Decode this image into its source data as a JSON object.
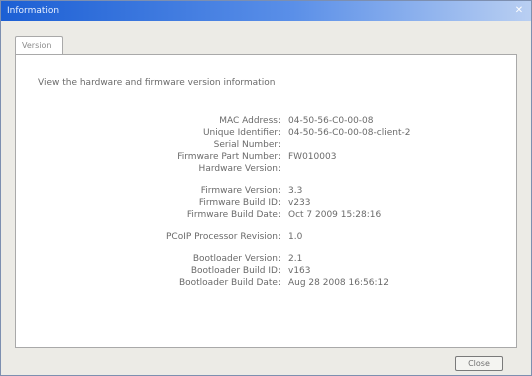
{
  "window": {
    "title": "Information",
    "close_glyph": "✕"
  },
  "tabs": [
    {
      "label": "Version"
    }
  ],
  "panel": {
    "description": "View the hardware and firmware version information",
    "fields": [
      {
        "label": "MAC Address:",
        "value": "04-50-56-C0-00-08"
      },
      {
        "label": "Unique Identifier:",
        "value": "04-50-56-C0-00-08-client-2"
      },
      {
        "label": "Serial Number:",
        "value": ""
      },
      {
        "label": "Firmware Part Number:",
        "value": "FW010003"
      },
      {
        "label": "Hardware Version:",
        "value": ""
      },
      {
        "label": "Firmware Version:",
        "value": "3.3"
      },
      {
        "label": "Firmware Build ID:",
        "value": "v233"
      },
      {
        "label": "Firmware Build Date:",
        "value": "Oct  7 2009 15:28:16"
      },
      {
        "label": "PCoIP Processor Revision:",
        "value": "1.0"
      },
      {
        "label": "Bootloader Version:",
        "value": "2.1"
      },
      {
        "label": "Bootloader Build ID:",
        "value": "v163"
      },
      {
        "label": "Bootloader Build Date:",
        "value": "Aug 28 2008 16:56:12"
      }
    ]
  },
  "footer": {
    "close_label": "Close"
  }
}
